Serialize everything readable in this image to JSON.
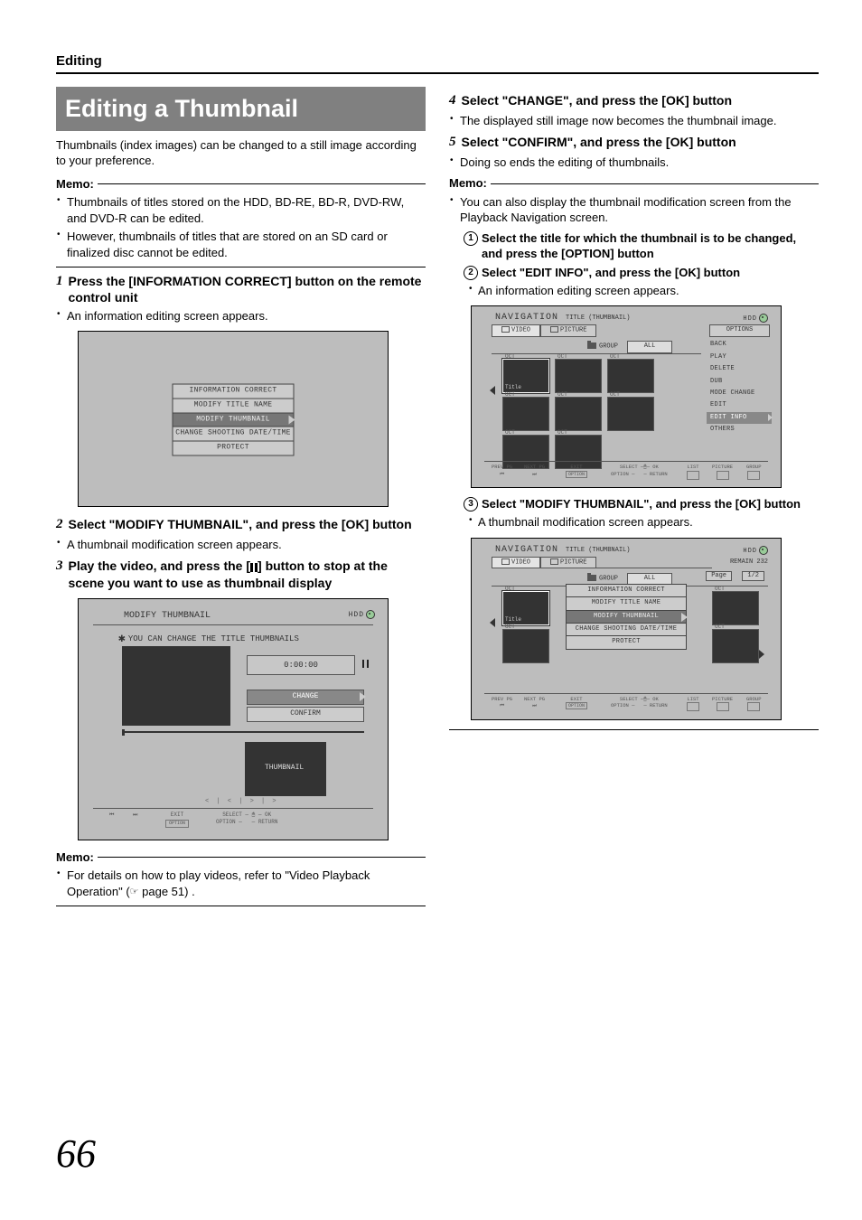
{
  "header": {
    "section": "Editing"
  },
  "page_number": "66",
  "left": {
    "headline": "Editing a Thumbnail",
    "intro": "Thumbnails (index images) can be changed to a still image according to your preference.",
    "memo1_label": "Memo:",
    "memo1_items": [
      "Thumbnails of titles stored on the HDD, BD-RE, BD-R, DVD-RW, and DVD-R can be edited.",
      "However, thumbnails of titles that are stored on an SD card or finalized disc cannot be edited."
    ],
    "step1_num": "1",
    "step1_text": "Press the [INFORMATION CORRECT] button on the remote control unit",
    "step1_note": "An information editing screen appears.",
    "osd1_items": [
      "INFORMATION CORRECT",
      "MODIFY TITLE NAME",
      "MODIFY THUMBNAIL",
      "CHANGE SHOOTING DATE/TIME",
      "PROTECT"
    ],
    "step2_num": "2",
    "step2_text": "Select \"MODIFY THUMBNAIL\", and press the [OK] button",
    "step2_note": "A thumbnail modification screen appears.",
    "step3_num": "3",
    "step3_text_pre": "Play the video, and press the [",
    "step3_text_post": "] button to stop at the scene you want to use as thumbnail display",
    "osd2": {
      "title": "MODIFY THUMBNAIL",
      "hdd": "HDD",
      "asterisk_line": "YOU CAN CHANGE THE TITLE THUMBNAILS",
      "time": "0:00:00",
      "change": "CHANGE",
      "confirm": "CONFIRM",
      "thumb_label": "THUMBNAIL",
      "ticks": "< | < | > | >",
      "footer_exit": "EXIT",
      "footer_select": "SELECT",
      "footer_ok": "OK",
      "footer_option": "OPTION",
      "footer_return": "RETURN"
    },
    "memo2_label": "Memo:",
    "memo2_item_pre": "For details on how to play videos, refer to \"Video Playback Operation\" (",
    "memo2_item_post": " page 51) ."
  },
  "right": {
    "step4_num": "4",
    "step4_text": "Select \"CHANGE\", and press the [OK] button",
    "step4_note": "The displayed still image now becomes the thumbnail image.",
    "step5_num": "5",
    "step5_text": "Select \"CONFIRM\", and press the [OK] button",
    "step5_note": "Doing so ends the editing of thumbnails.",
    "memo_label": "Memo:",
    "memo_item": "You can also display the thumbnail modification screen from the Playback Navigation screen.",
    "sub1_num": "1",
    "sub1_text": "Select the title for which the thumbnail is to be changed, and press the [OPTION] button",
    "sub2_num": "2",
    "sub2_text": "Select \"EDIT INFO\", and press the [OK] button",
    "sub2_note": "An information editing screen appears.",
    "nav1": {
      "title": "NAVIGATION",
      "subtitle": "TITLE (THUMBNAIL)",
      "hdd": "HDD",
      "tab_video": "VIDEO",
      "tab_picture": "PICTURE",
      "options": "OPTIONS",
      "side": [
        "BACK",
        "PLAY",
        "DELETE",
        "DUB",
        "MODE CHANGE",
        "EDIT",
        "EDIT INFO",
        "OTHERS"
      ],
      "side_selected_index": 6,
      "group_label": "GROUP",
      "group_value": "ALL",
      "thumb_label": "OCT",
      "footer": {
        "prev": "PREV PG",
        "next": "NEXT PG",
        "exit": "EXIT",
        "select": "SELECT",
        "ok": "OK",
        "option": "OPTION",
        "return": "RETURN",
        "list": "LIST",
        "picture": "PICTURE",
        "group": "GROUP"
      }
    },
    "sub3_num": "3",
    "sub3_text": "Select \"MODIFY THUMBNAIL\", and press the [OK] button",
    "sub3_note": "A thumbnail modification screen appears.",
    "nav2": {
      "title": "NAVIGATION",
      "subtitle": "TITLE (THUMBNAIL)",
      "hdd": "HDD",
      "tab_video": "VIDEO",
      "tab_picture": "PICTURE",
      "remain": "REMAIN 232",
      "page_label": "Page",
      "page_value": "1/2",
      "group_label": "GROUP",
      "group_value": "ALL",
      "overlay_items": [
        "INFORMATION CORRECT",
        "MODIFY TITLE NAME",
        "MODIFY THUMBNAIL",
        "CHANGE SHOOTING DATE/TIME",
        "PROTECT"
      ],
      "overlay_selected_index": 2,
      "thumb_label": "OCT",
      "footer": {
        "prev": "PREV PG",
        "next": "NEXT PG",
        "exit": "EXIT",
        "select": "SELECT",
        "ok": "OK",
        "option": "OPTION",
        "return": "RETURN",
        "list": "LIST",
        "picture": "PICTURE",
        "group": "GROUP"
      }
    }
  }
}
